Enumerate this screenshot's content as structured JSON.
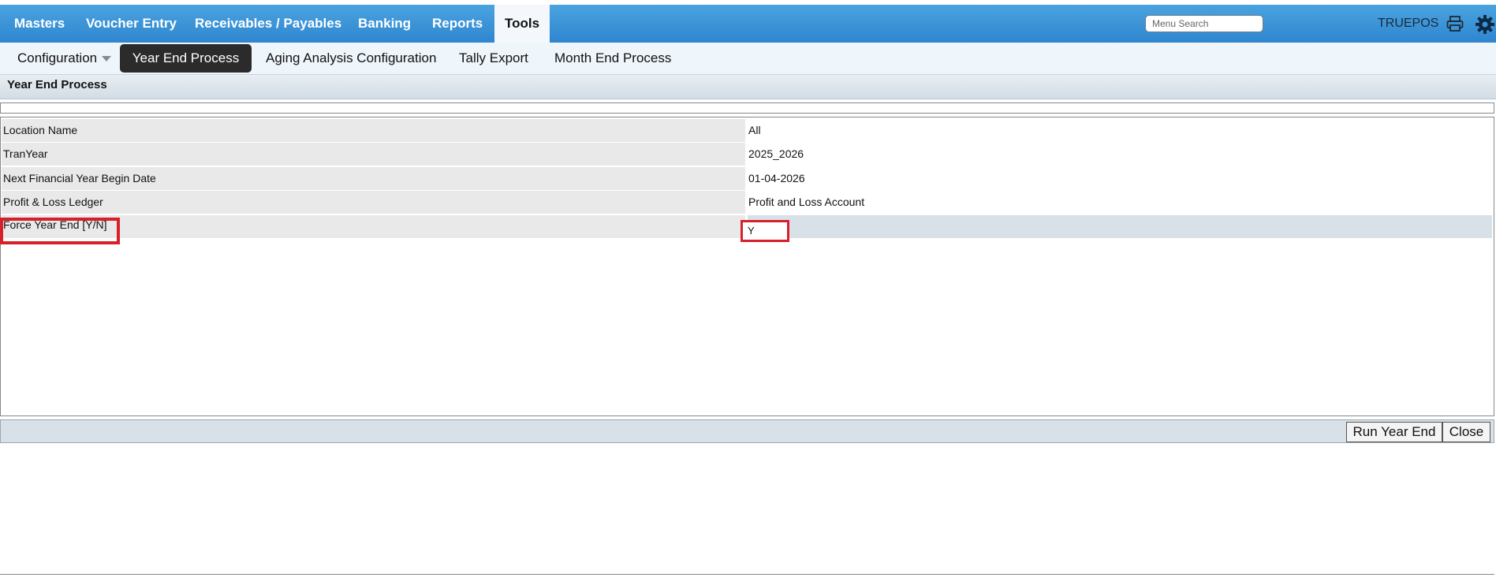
{
  "top_nav": {
    "items": [
      "Masters",
      "Voucher Entry",
      "Receivables / Payables",
      "Banking",
      "Reports",
      "Tools"
    ],
    "active": "Tools",
    "search_placeholder": "Menu Search",
    "user": "TRUEPOS",
    "print_icon": "printer-icon",
    "settings_icon": "gear-icon"
  },
  "sub_nav": {
    "items": [
      "Configuration",
      "Year End Process",
      "Aging Analysis Configuration",
      "Tally Export",
      "Month End Process"
    ],
    "active": "Year End Process"
  },
  "panel": {
    "title": "Year End Process"
  },
  "form": {
    "rows": [
      {
        "label": "Location Name",
        "value": "All"
      },
      {
        "label": "TranYear",
        "value": "2025_2026"
      },
      {
        "label": "Next Financial Year Begin Date",
        "value": "01-04-2026"
      },
      {
        "label": "Profit & Loss Ledger",
        "value": "Profit and Loss Account"
      },
      {
        "label": "Force Year End [Y/N]",
        "value": "Y"
      }
    ]
  },
  "actions": {
    "run_label": "Run Year End",
    "close_label": "Close"
  },
  "colors": {
    "nav_blue": "#3a94d8",
    "highlight_red": "#d8202a",
    "active_sub_bg": "#2b2b2b"
  }
}
